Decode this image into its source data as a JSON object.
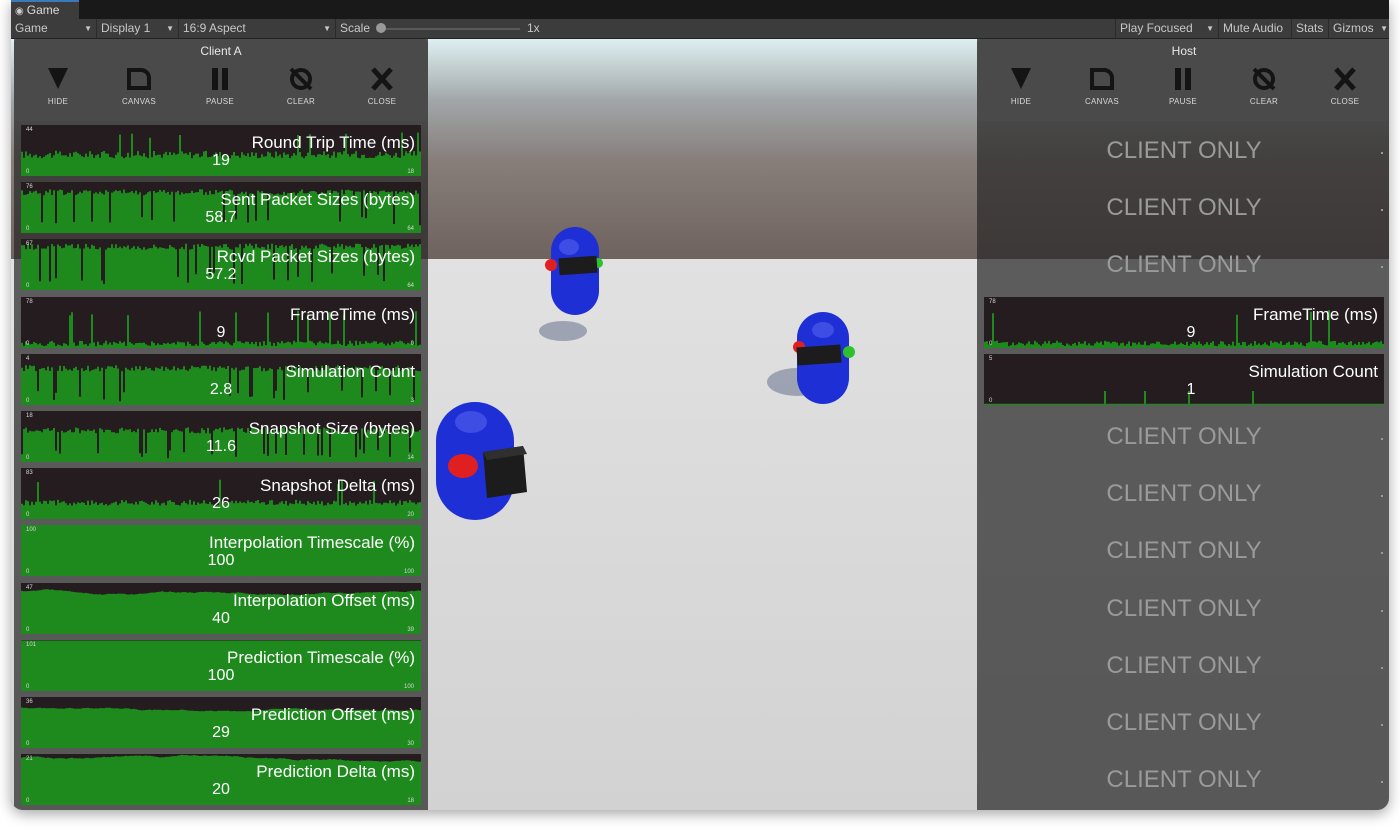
{
  "window": {
    "tab_label": "Game",
    "tab_icon": "gamepad-icon"
  },
  "toolbar": {
    "view": "Game",
    "display": "Display 1",
    "aspect": "16:9 Aspect",
    "scale_label": "Scale",
    "scale_value": "1x",
    "play_mode": "Play Focused",
    "mute": "Mute Audio",
    "stats": "Stats",
    "gizmos": "Gizmos"
  },
  "buttons": [
    {
      "label": "HIDE",
      "icon": "triangle-down-icon"
    },
    {
      "label": "CANVAS",
      "icon": "canvas-icon"
    },
    {
      "label": "PAUSE",
      "icon": "pause-icon"
    },
    {
      "label": "CLEAR",
      "icon": "clear-icon"
    },
    {
      "label": "CLOSE",
      "icon": "close-icon"
    }
  ],
  "client_panel": {
    "title": "Client A",
    "graphs": [
      {
        "title": "Round Trip Time (ms)",
        "value": "19",
        "max": "44",
        "min": "0",
        "right": "18",
        "fill": 0.42,
        "noise": "medium"
      },
      {
        "title": "Sent Packet Sizes (bytes)",
        "value": "58.7",
        "max": "76",
        "min": "0",
        "right": "64",
        "fill": 0.8,
        "noise": "spiky"
      },
      {
        "title": "Rcvd Packet Sizes (bytes)",
        "value": "57.2",
        "max": "67",
        "min": "0",
        "right": "64",
        "fill": 0.85,
        "noise": "spiky"
      },
      {
        "title": "FrameTime (ms)",
        "value": "9",
        "max": "78",
        "min": "0",
        "right": "0",
        "fill": 0.12,
        "noise": "low"
      },
      {
        "title": "Simulation Count",
        "value": "2.8",
        "max": "4",
        "min": "0",
        "right": "3",
        "fill": 0.72,
        "noise": "spiky"
      },
      {
        "title": "Snapshot Size (bytes)",
        "value": "11.6",
        "max": "18",
        "min": "0",
        "right": "14",
        "fill": 0.62,
        "noise": "spiky"
      },
      {
        "title": "Snapshot Delta (ms)",
        "value": "26",
        "max": "83",
        "min": "0",
        "right": "20",
        "fill": 0.32,
        "noise": "medium"
      },
      {
        "title": "Interpolation Timescale (%)",
        "value": "100",
        "max": "100",
        "min": "0",
        "right": "100",
        "fill": 1.0,
        "noise": "none"
      },
      {
        "title": "Interpolation Offset (ms)",
        "value": "40",
        "max": "47",
        "min": "0",
        "right": "39",
        "fill": 0.84,
        "noise": "smooth"
      },
      {
        "title": "Prediction Timescale (%)",
        "value": "100",
        "max": "101",
        "min": "0",
        "right": "100",
        "fill": 0.99,
        "noise": "none"
      },
      {
        "title": "Prediction Offset (ms)",
        "value": "29",
        "max": "36",
        "min": "0",
        "right": "30",
        "fill": 0.8,
        "noise": "smooth"
      },
      {
        "title": "Prediction Delta (ms)",
        "value": "20",
        "max": "21",
        "min": "0",
        "right": "18",
        "fill": 0.93,
        "noise": "smooth"
      }
    ]
  },
  "host_panel": {
    "title": "Host",
    "rows": [
      {
        "kind": "client_only",
        "text": "CLIENT ONLY"
      },
      {
        "kind": "client_only",
        "text": "CLIENT ONLY"
      },
      {
        "kind": "client_only",
        "text": "CLIENT ONLY"
      },
      {
        "kind": "graph",
        "title": "FrameTime (ms)",
        "value": "9",
        "max": "78",
        "min": "0",
        "right": "",
        "fill": 0.12,
        "noise": "low"
      },
      {
        "kind": "graph",
        "title": "Simulation Count",
        "value": "1",
        "max": "5",
        "min": "0",
        "right": "",
        "fill": 0.2,
        "noise": "flat"
      },
      {
        "kind": "client_only",
        "text": "CLIENT ONLY"
      },
      {
        "kind": "client_only",
        "text": "CLIENT ONLY"
      },
      {
        "kind": "client_only",
        "text": "CLIENT ONLY"
      },
      {
        "kind": "client_only",
        "text": "CLIENT ONLY"
      },
      {
        "kind": "client_only",
        "text": "CLIENT ONLY"
      },
      {
        "kind": "client_only",
        "text": "CLIENT ONLY"
      },
      {
        "kind": "client_only",
        "text": "CLIENT ONLY"
      }
    ]
  },
  "colors": {
    "graph_bg": "#1e8a1e",
    "graph_peak": "#241c1e",
    "panel_header": "#4a4a4a",
    "player_body": "#1f2fd6",
    "player_visor": "#1c1c1c"
  }
}
